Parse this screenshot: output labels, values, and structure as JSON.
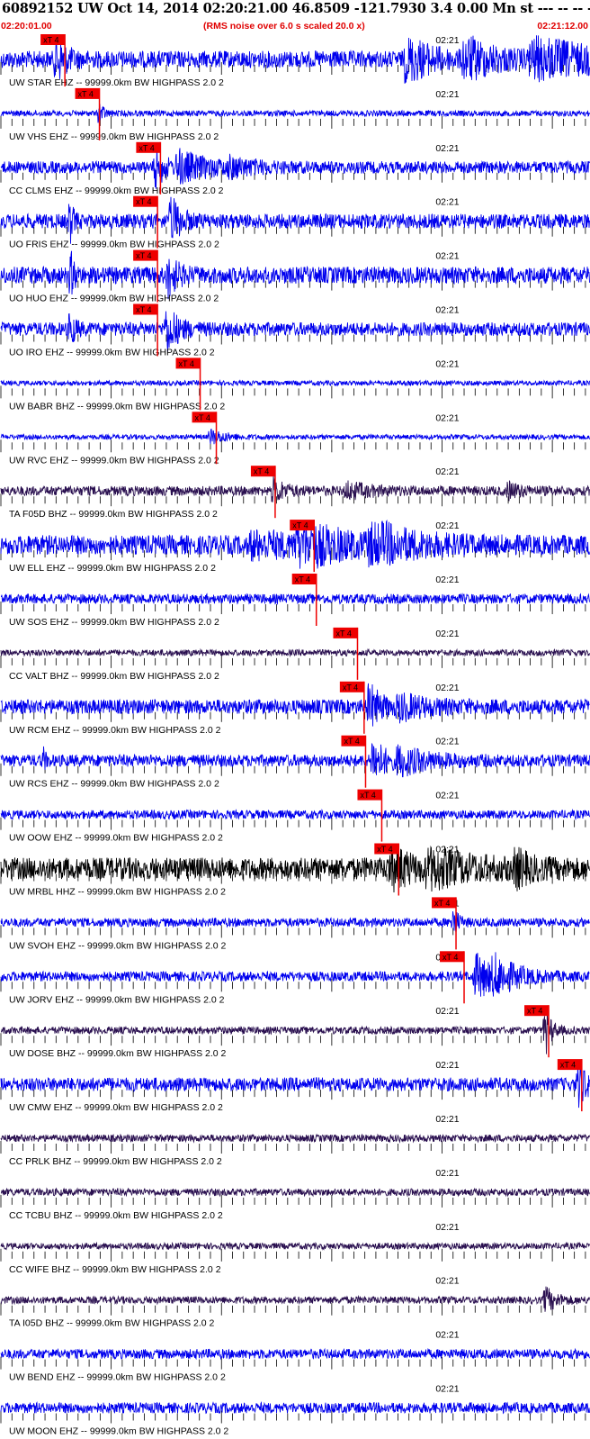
{
  "header": {
    "title": "60892152 UW Oct 14, 2014 02:20:21.00   46.8509 -121.7930  3.4 0.00 Mn st --- -- --  -1",
    "start_time": "02:20:01.00",
    "scale_note": "(RMS noise over 6.0 s scaled 20.0 x)",
    "end_time": "02:21:12.00"
  },
  "colors": {
    "trace_blue": "#0000ee",
    "trace_dark": "#2a1050",
    "trace_black": "#000000",
    "pick_red": "#ee0000",
    "baseline": "#000000"
  },
  "chart_data": {
    "type": "line",
    "title": "60892152 UW Oct 14, 2014 02:20:21.00   46.8509 -121.7930  3.4 0.00 Mn st --- -- --  -1",
    "x_start": "02:20:01.00",
    "x_end": "02:21:12.00",
    "x_range_seconds": [
      0,
      71
    ],
    "minute_label": "02:21",
    "minute_mark_seconds": 59,
    "pick_label": "xT 4",
    "filter": "99999.0km BW  HIGHPASS  2.0  2",
    "series": [
      {
        "station": "UW STAR EHZ --",
        "color": "blue",
        "amp": 0.35,
        "pick_s": 8.7,
        "bursts": [
          [
            7.5,
            1.2,
            0.9
          ],
          [
            55,
            3,
            1.0
          ],
          [
            63,
            4,
            0.8
          ],
          [
            72,
            10,
            0.7
          ]
        ]
      },
      {
        "station": "UW VHS EHZ --",
        "color": "blue",
        "amp": 0.12,
        "pick_s": 13.4,
        "bursts": [
          [
            13.4,
            0.5,
            0.5
          ]
        ]
      },
      {
        "station": "CC CLMS EHZ --",
        "color": "blue",
        "amp": 0.25,
        "pick_s": 21.7,
        "bursts": [
          [
            21,
            1,
            1.0
          ],
          [
            24,
            4,
            0.6
          ],
          [
            31,
            3,
            0.25
          ]
        ]
      },
      {
        "station": "UO FRIS EHZ --",
        "color": "blue",
        "amp": 0.3,
        "pick_s": 21.3,
        "bursts": [
          [
            9.4,
            0.4,
            0.9
          ],
          [
            23.1,
            1.2,
            1.0
          ]
        ]
      },
      {
        "station": "UO HUO EHZ --",
        "color": "blue",
        "amp": 0.35,
        "pick_s": 21.3,
        "bursts": [
          [
            9.5,
            0.5,
            0.8
          ],
          [
            22.7,
            1.0,
            1.0
          ]
        ]
      },
      {
        "station": "UO IRO EHZ --",
        "color": "blue",
        "amp": 0.28,
        "pick_s": 21.3,
        "bursts": [
          [
            9.4,
            0.6,
            0.7
          ],
          [
            22.5,
            1.4,
            1.0
          ]
        ]
      },
      {
        "station": "UW BABR BHZ --",
        "color": "blue",
        "amp": 0.1,
        "pick_s": 27.1,
        "bursts": []
      },
      {
        "station": "UW RVC EHZ --",
        "color": "blue",
        "amp": 0.1,
        "pick_s": 29.3,
        "bursts": [
          [
            28.5,
            2,
            0.3
          ]
        ]
      },
      {
        "station": "TA F05D BHZ --",
        "color": "dark",
        "amp": 0.2,
        "pick_s": 37.3,
        "bursts": [
          [
            37,
            1.5,
            0.5
          ],
          [
            47,
            3,
            0.3
          ],
          [
            69,
            1.5,
            0.3
          ]
        ]
      },
      {
        "station": "UW ELL EHZ --",
        "color": "blue",
        "amp": 0.4,
        "pick_s": 42.6,
        "bursts": [
          [
            40,
            5,
            0.9
          ],
          [
            50,
            5,
            0.8
          ],
          [
            34,
            8,
            0.35
          ]
        ]
      },
      {
        "station": "UW SOS EHZ --",
        "color": "blue",
        "amp": 0.2,
        "pick_s": 42.9,
        "bursts": []
      },
      {
        "station": "CC VALT BHZ --",
        "color": "dark",
        "amp": 0.13,
        "pick_s": 48.5,
        "bursts": []
      },
      {
        "station": "UW RCM EHZ --",
        "color": "blue",
        "amp": 0.3,
        "pick_s": 49.4,
        "bursts": [
          [
            50,
            1.5,
            0.9
          ],
          [
            54,
            4,
            0.4
          ]
        ]
      },
      {
        "station": "UW RCS EHZ --",
        "color": "blue",
        "amp": 0.25,
        "pick_s": 49.6,
        "bursts": [
          [
            5.8,
            0.3,
            0.4
          ],
          [
            50.5,
            1.5,
            1.0
          ],
          [
            54,
            4,
            0.5
          ]
        ]
      },
      {
        "station": "UW OOW EHZ --",
        "color": "blue",
        "amp": 0.18,
        "pick_s": 51.8,
        "bursts": []
      },
      {
        "station": "UW MRBL HHZ --",
        "color": "black",
        "amp": 0.45,
        "pick_s": 54.1,
        "bursts": [
          [
            53,
            2,
            1.0
          ],
          [
            58,
            5,
            0.7
          ],
          [
            70,
            1.5,
            0.6
          ]
        ]
      },
      {
        "station": "UW SVOH EHZ --",
        "color": "blue",
        "amp": 0.18,
        "pick_s": 61.9,
        "bursts": [
          [
            61.5,
            0.6,
            0.7
          ]
        ]
      },
      {
        "station": "UW JORV EHZ --",
        "color": "blue",
        "amp": 0.2,
        "pick_s": 63.0,
        "bursts": [
          [
            64.5,
            2.5,
            1.0
          ],
          [
            67,
            3,
            0.6
          ]
        ]
      },
      {
        "station": "UW DOSE BHZ --",
        "color": "dark",
        "amp": 0.15,
        "pick_s": 74.5,
        "bursts": [
          [
            74,
            0.8,
            1.0
          ]
        ]
      },
      {
        "station": "UW CMW EHZ --",
        "color": "blue",
        "amp": 0.28,
        "pick_s": 79.0,
        "bursts": [
          [
            78.5,
            1.0,
            1.0
          ]
        ]
      },
      {
        "station": "CC PRLK BHZ --",
        "color": "dark",
        "amp": 0.15,
        "pick_s": null,
        "bursts": []
      },
      {
        "station": "CC TCBU BHZ --",
        "color": "dark",
        "amp": 0.15,
        "pick_s": null,
        "bursts": []
      },
      {
        "station": "CC WIFE BHZ --",
        "color": "dark",
        "amp": 0.13,
        "pick_s": null,
        "bursts": []
      },
      {
        "station": "TA I05D BHZ --",
        "color": "dark",
        "amp": 0.15,
        "pick_s": null,
        "bursts": [
          [
            74,
            1.5,
            0.5
          ]
        ]
      },
      {
        "station": "UW BEND EHZ --",
        "color": "blue",
        "amp": 0.2,
        "pick_s": null,
        "bursts": []
      },
      {
        "station": "UW MOON EHZ --",
        "color": "blue",
        "amp": 0.22,
        "pick_s": null,
        "bursts": []
      }
    ]
  }
}
